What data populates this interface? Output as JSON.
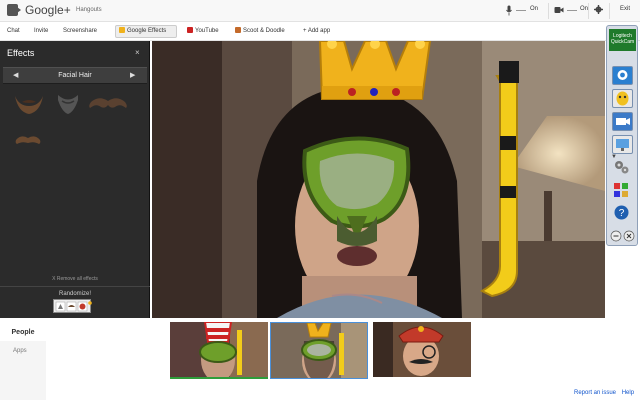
{
  "topbar": {
    "brand": "Google+",
    "product": "Hangouts",
    "mic_status": "On",
    "cam_status": "On",
    "exit_label": "Exit"
  },
  "toolbar": {
    "tabs": [
      {
        "label": "Chat"
      },
      {
        "label": "Invite"
      },
      {
        "label": "Screenshare"
      },
      {
        "label": "Google Effects"
      },
      {
        "label": "YouTube"
      },
      {
        "label": "Scoot & Doodle"
      },
      {
        "label": "+ Add app"
      }
    ]
  },
  "effects": {
    "title": "Effects",
    "close": "×",
    "category": "Facial Hair",
    "prev_arrow": "◀",
    "next_arrow": "▶",
    "remove_all": "X Remove all effects",
    "randomize": "Randomize!"
  },
  "quickcam": {
    "title_line1": "Logitech",
    "title_line2": "QuickCam"
  },
  "people_panel": {
    "people_tab": "People",
    "apps_tab": "Apps"
  },
  "footer": {
    "report": "Report an issue",
    "help": "Help"
  },
  "colors": {
    "crown": "#f0b21c",
    "mask": "#7fae2a",
    "snorkel": "#f2cc1a",
    "active_border": "#4a90d9",
    "speaker_border": "#2e9d3a"
  }
}
